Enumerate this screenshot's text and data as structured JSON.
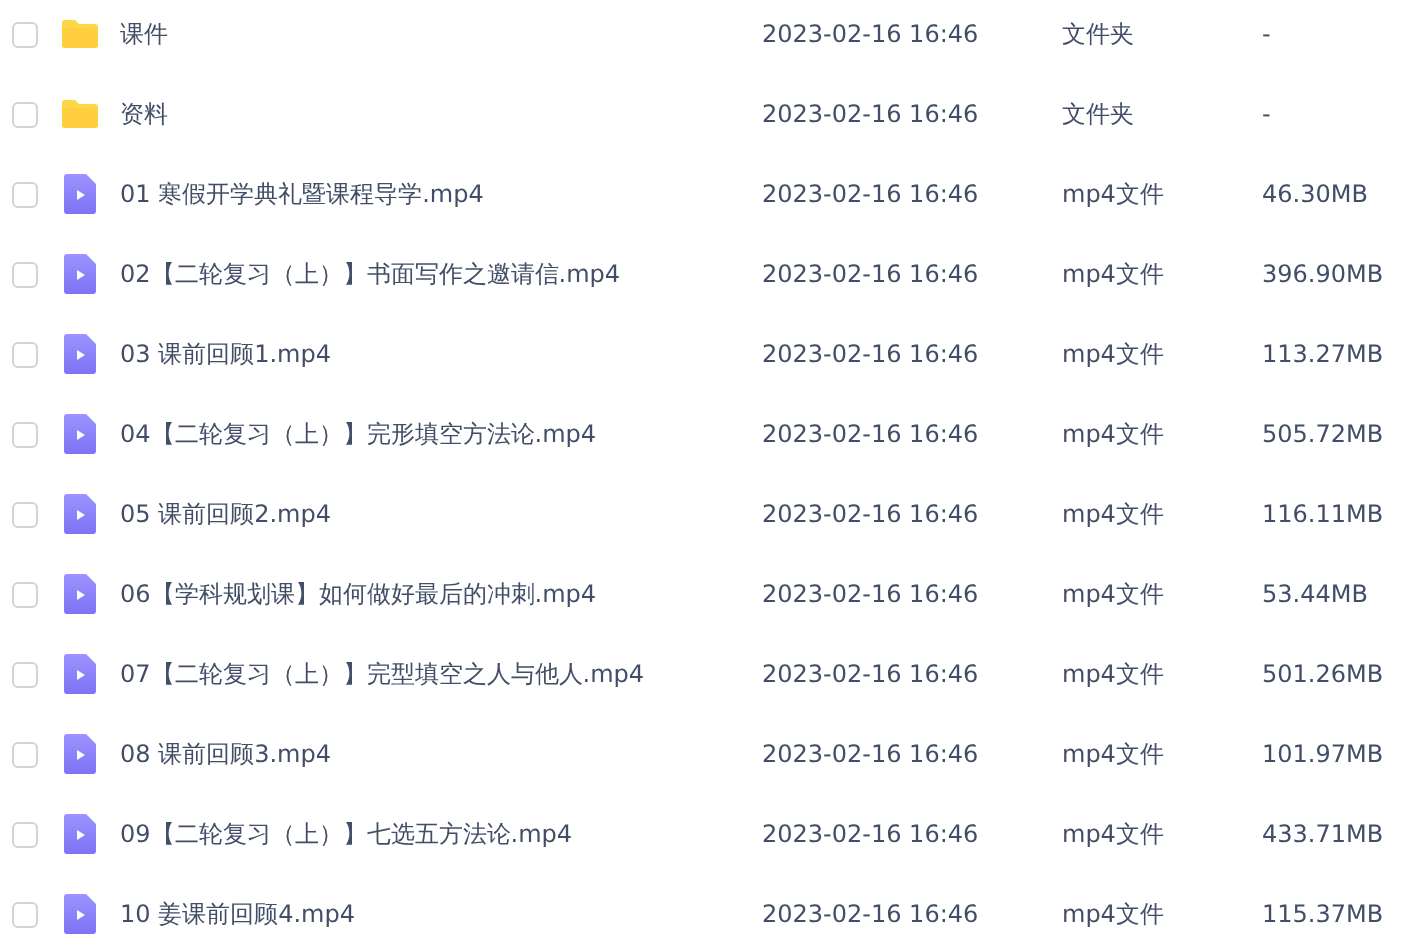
{
  "files": [
    {
      "kind": "folder",
      "checked": false,
      "name": "课件",
      "modified": "2023-02-16 16:46",
      "type": "文件夹",
      "size": "-"
    },
    {
      "kind": "folder",
      "checked": false,
      "name": "资料",
      "modified": "2023-02-16 16:46",
      "type": "文件夹",
      "size": "-"
    },
    {
      "kind": "video",
      "checked": false,
      "name": "01 寒假开学典礼暨课程导学.mp4",
      "modified": "2023-02-16 16:46",
      "type": "mp4文件",
      "size": "46.30MB"
    },
    {
      "kind": "video",
      "checked": false,
      "name": "02【二轮复习（上）】书面写作之邀请信.mp4",
      "modified": "2023-02-16 16:46",
      "type": "mp4文件",
      "size": "396.90MB"
    },
    {
      "kind": "video",
      "checked": false,
      "name": "03 课前回顾1.mp4",
      "modified": "2023-02-16 16:46",
      "type": "mp4文件",
      "size": "113.27MB"
    },
    {
      "kind": "video",
      "checked": false,
      "name": "04【二轮复习（上）】完形填空方法论.mp4",
      "modified": "2023-02-16 16:46",
      "type": "mp4文件",
      "size": "505.72MB"
    },
    {
      "kind": "video",
      "checked": false,
      "name": "05 课前回顾2.mp4",
      "modified": "2023-02-16 16:46",
      "type": "mp4文件",
      "size": "116.11MB"
    },
    {
      "kind": "video",
      "checked": false,
      "name": "06【学科规划课】如何做好最后的冲刺.mp4",
      "modified": "2023-02-16 16:46",
      "type": "mp4文件",
      "size": "53.44MB"
    },
    {
      "kind": "video",
      "checked": false,
      "name": "07【二轮复习（上）】完型填空之人与他人.mp4",
      "modified": "2023-02-16 16:46",
      "type": "mp4文件",
      "size": "501.26MB"
    },
    {
      "kind": "video",
      "checked": false,
      "name": "08 课前回顾3.mp4",
      "modified": "2023-02-16 16:46",
      "type": "mp4文件",
      "size": "101.97MB"
    },
    {
      "kind": "video",
      "checked": false,
      "name": "09【二轮复习（上）】七选五方法论.mp4",
      "modified": "2023-02-16 16:46",
      "type": "mp4文件",
      "size": "433.71MB"
    },
    {
      "kind": "video",
      "checked": false,
      "name": "10 姜课前回顾4.mp4",
      "modified": "2023-02-16 16:46",
      "type": "mp4文件",
      "size": "115.37MB"
    }
  ]
}
